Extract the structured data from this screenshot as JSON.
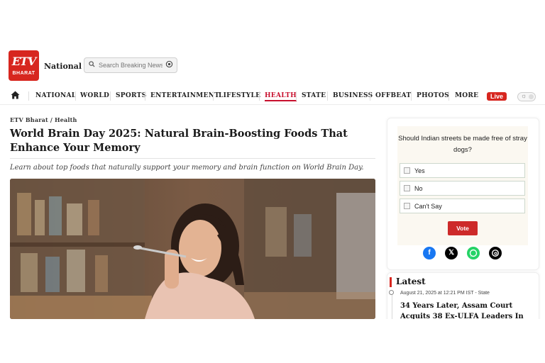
{
  "header": {
    "logo_text": "ETV",
    "logo_sub": "BHARAT",
    "edition": "National",
    "search_placeholder": "Search Breaking News"
  },
  "nav": {
    "items": [
      "NATIONAL",
      "WORLD",
      "SPORTS",
      "ENTERTAINMENT",
      "LIFESTYLE",
      "HEALTH",
      "STATE",
      "BUSINESS",
      "OFFBEAT",
      "PHOTOS",
      "MORE"
    ],
    "active": "HEALTH",
    "live_label": "Live"
  },
  "article": {
    "breadcrumb": "ETV Bharat / Health",
    "headline": "World Brain Day 2025: Natural Brain-Boosting Foods That Enhance Your Memory",
    "summary": "Learn about top foods that naturally support your memory and brain function on World Brain Day."
  },
  "poll": {
    "question": "Should Indian streets be made free of stray dogs?",
    "options": [
      "Yes",
      "No",
      "Can't Say"
    ],
    "vote_label": "Vote",
    "share_icons": [
      "facebook-icon",
      "x-icon",
      "whatsapp-icon",
      "threads-icon"
    ]
  },
  "latest": {
    "title": "Latest",
    "items": [
      {
        "meta": "August 21, 2025 at 12:21 PM IST - State",
        "headline": "34 Years Later, Assam Court Acquits 38 Ex-ULFA Leaders In"
      }
    ]
  },
  "colors": {
    "brand_red": "#d7261f",
    "active_nav": "#c8102e"
  }
}
